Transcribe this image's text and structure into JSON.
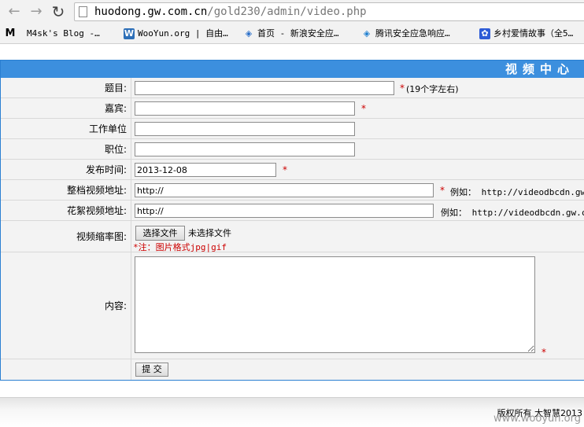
{
  "browser": {
    "url_host": "huodong.gw.com.cn",
    "url_path": "/gold230/admin/video.php",
    "bookmarks": [
      {
        "icon": "M",
        "label": "M4sk's Blog -…"
      },
      {
        "icon": "W",
        "label": "WooYun.org | 自由…"
      },
      {
        "icon": "◈",
        "label": "首页 - 新浪安全应…"
      },
      {
        "icon": "◈",
        "label": "腾讯安全应急响应…"
      },
      {
        "icon": "✿",
        "label": "乡村爱情故事（全5…"
      }
    ]
  },
  "panel": {
    "title": "视频中心"
  },
  "form": {
    "title_label": "题目:",
    "title_value": "",
    "title_hint": "(19个字左右)",
    "guest_label": "嘉宾:",
    "guest_value": "",
    "company_label": "工作单位",
    "company_value": "",
    "position_label": "职位:",
    "position_value": "",
    "date_label": "发布时间:",
    "date_value": "2013-12-08",
    "full_video_label": "整档视频地址:",
    "full_video_value": "http://",
    "full_video_example": "例如：  http://videodbcdn.gw.c",
    "highlight_video_label": "花絮视频地址:",
    "highlight_video_value": "http://",
    "highlight_video_example": "例如：  http://videodbcdn.gw.com",
    "thumbnail_label": "视频缩率图:",
    "file_button": "选择文件",
    "file_status": "未选择文件",
    "file_note": "*注：图片格式jpg|gif",
    "content_label": "内容:",
    "content_value": "",
    "required_mark": "*",
    "submit_label": "提 交"
  },
  "footer": {
    "copyright": "版权所有  大智慧2013",
    "watermark": "www.wooyun.org"
  }
}
